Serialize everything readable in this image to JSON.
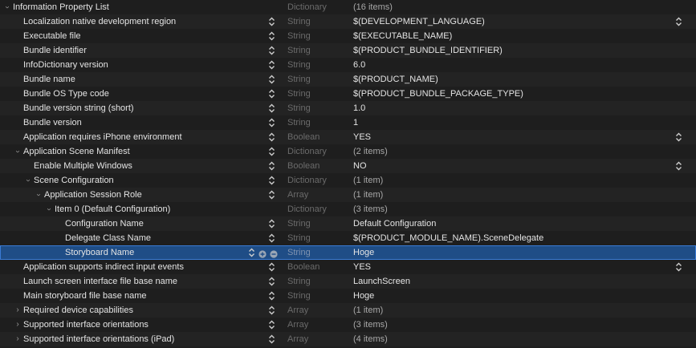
{
  "rows": [
    {
      "key": "Information Property List",
      "type": "Dictionary",
      "value": "(16 items)",
      "level": 0,
      "disc": "open",
      "stepper": false,
      "valStepper": false,
      "muted": true
    },
    {
      "key": "Localization native development region",
      "type": "String",
      "value": "$(DEVELOPMENT_LANGUAGE)",
      "level": 1,
      "disc": "none",
      "stepper": true,
      "valStepper": true
    },
    {
      "key": "Executable file",
      "type": "String",
      "value": "$(EXECUTABLE_NAME)",
      "level": 1,
      "disc": "none",
      "stepper": true,
      "valStepper": false
    },
    {
      "key": "Bundle identifier",
      "type": "String",
      "value": "$(PRODUCT_BUNDLE_IDENTIFIER)",
      "level": 1,
      "disc": "none",
      "stepper": true,
      "valStepper": false
    },
    {
      "key": "InfoDictionary version",
      "type": "String",
      "value": "6.0",
      "level": 1,
      "disc": "none",
      "stepper": true,
      "valStepper": false
    },
    {
      "key": "Bundle name",
      "type": "String",
      "value": "$(PRODUCT_NAME)",
      "level": 1,
      "disc": "none",
      "stepper": true,
      "valStepper": false
    },
    {
      "key": "Bundle OS Type code",
      "type": "String",
      "value": "$(PRODUCT_BUNDLE_PACKAGE_TYPE)",
      "level": 1,
      "disc": "none",
      "stepper": true,
      "valStepper": false
    },
    {
      "key": "Bundle version string (short)",
      "type": "String",
      "value": "1.0",
      "level": 1,
      "disc": "none",
      "stepper": true,
      "valStepper": false
    },
    {
      "key": "Bundle version",
      "type": "String",
      "value": "1",
      "level": 1,
      "disc": "none",
      "stepper": true,
      "valStepper": false
    },
    {
      "key": "Application requires iPhone environment",
      "type": "Boolean",
      "value": "YES",
      "level": 1,
      "disc": "none",
      "stepper": true,
      "valStepper": true
    },
    {
      "key": "Application Scene Manifest",
      "type": "Dictionary",
      "value": "(2 items)",
      "level": 1,
      "disc": "open",
      "stepper": true,
      "valStepper": false,
      "muted": true
    },
    {
      "key": "Enable Multiple Windows",
      "type": "Boolean",
      "value": "NO",
      "level": 2,
      "disc": "none",
      "stepper": true,
      "valStepper": true
    },
    {
      "key": "Scene Configuration",
      "type": "Dictionary",
      "value": "(1 item)",
      "level": 2,
      "disc": "open",
      "stepper": true,
      "valStepper": false,
      "muted": true
    },
    {
      "key": "Application Session Role",
      "type": "Array",
      "value": "(1 item)",
      "level": 3,
      "disc": "open",
      "stepper": true,
      "valStepper": false,
      "muted": true
    },
    {
      "key": "Item 0 (Default Configuration)",
      "type": "Dictionary",
      "value": "(3 items)",
      "level": 4,
      "disc": "open",
      "stepper": false,
      "valStepper": false,
      "muted": true
    },
    {
      "key": "Configuration Name",
      "type": "String",
      "value": "Default Configuration",
      "level": 5,
      "disc": "none",
      "stepper": true,
      "valStepper": false
    },
    {
      "key": "Delegate Class Name",
      "type": "String",
      "value": "$(PRODUCT_MODULE_NAME).SceneDelegate",
      "level": 5,
      "disc": "none",
      "stepper": true,
      "valStepper": false
    },
    {
      "key": "Storyboard Name",
      "type": "String",
      "value": "Hoge",
      "level": 5,
      "disc": "none",
      "stepper": true,
      "valStepper": false,
      "selected": true
    },
    {
      "key": "Application supports indirect input events",
      "type": "Boolean",
      "value": "YES",
      "level": 1,
      "disc": "none",
      "stepper": true,
      "valStepper": true
    },
    {
      "key": "Launch screen interface file base name",
      "type": "String",
      "value": "LaunchScreen",
      "level": 1,
      "disc": "none",
      "stepper": true,
      "valStepper": false
    },
    {
      "key": "Main storyboard file base name",
      "type": "String",
      "value": "Hoge",
      "level": 1,
      "disc": "none",
      "stepper": true,
      "valStepper": false
    },
    {
      "key": "Required device capabilities",
      "type": "Array",
      "value": "(1 item)",
      "level": 1,
      "disc": "closed",
      "stepper": true,
      "valStepper": false,
      "muted": true
    },
    {
      "key": "Supported interface orientations",
      "type": "Array",
      "value": "(3 items)",
      "level": 1,
      "disc": "closed",
      "stepper": true,
      "valStepper": false,
      "muted": true
    },
    {
      "key": "Supported interface orientations (iPad)",
      "type": "Array",
      "value": "(4 items)",
      "level": 1,
      "disc": "closed",
      "stepper": true,
      "valStepper": false,
      "muted": true
    }
  ],
  "colors": {
    "background": "#1e1e1e",
    "selection": "#1f4d86",
    "type_text": "#6b6b6b"
  },
  "icons": {
    "disclosure": "chevron-icon",
    "stepper": "up-down-stepper-icon",
    "add": "add-circle-icon",
    "remove": "remove-circle-icon"
  }
}
